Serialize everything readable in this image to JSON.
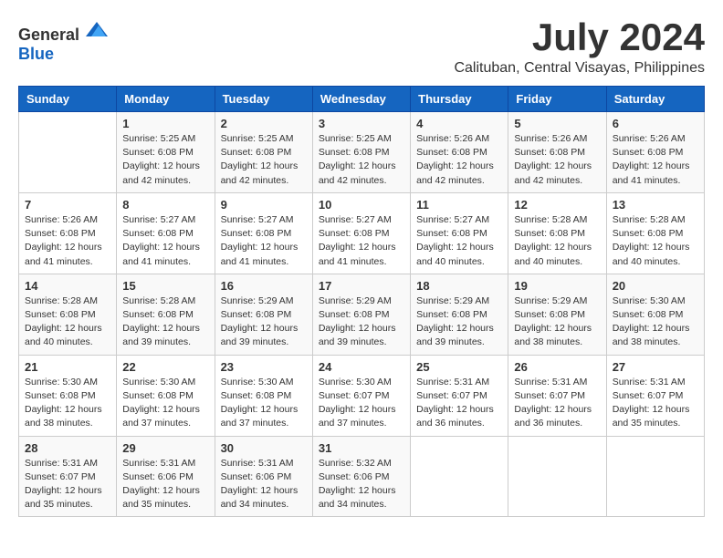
{
  "logo": {
    "text_general": "General",
    "text_blue": "Blue"
  },
  "title": "July 2024",
  "location": "Calituban, Central Visayas, Philippines",
  "header": {
    "days": [
      "Sunday",
      "Monday",
      "Tuesday",
      "Wednesday",
      "Thursday",
      "Friday",
      "Saturday"
    ]
  },
  "weeks": [
    {
      "cells": [
        {
          "day": "",
          "detail": ""
        },
        {
          "day": "1",
          "detail": "Sunrise: 5:25 AM\nSunset: 6:08 PM\nDaylight: 12 hours\nand 42 minutes."
        },
        {
          "day": "2",
          "detail": "Sunrise: 5:25 AM\nSunset: 6:08 PM\nDaylight: 12 hours\nand 42 minutes."
        },
        {
          "day": "3",
          "detail": "Sunrise: 5:25 AM\nSunset: 6:08 PM\nDaylight: 12 hours\nand 42 minutes."
        },
        {
          "day": "4",
          "detail": "Sunrise: 5:26 AM\nSunset: 6:08 PM\nDaylight: 12 hours\nand 42 minutes."
        },
        {
          "day": "5",
          "detail": "Sunrise: 5:26 AM\nSunset: 6:08 PM\nDaylight: 12 hours\nand 42 minutes."
        },
        {
          "day": "6",
          "detail": "Sunrise: 5:26 AM\nSunset: 6:08 PM\nDaylight: 12 hours\nand 41 minutes."
        }
      ]
    },
    {
      "cells": [
        {
          "day": "7",
          "detail": "Sunrise: 5:26 AM\nSunset: 6:08 PM\nDaylight: 12 hours\nand 41 minutes."
        },
        {
          "day": "8",
          "detail": "Sunrise: 5:27 AM\nSunset: 6:08 PM\nDaylight: 12 hours\nand 41 minutes."
        },
        {
          "day": "9",
          "detail": "Sunrise: 5:27 AM\nSunset: 6:08 PM\nDaylight: 12 hours\nand 41 minutes."
        },
        {
          "day": "10",
          "detail": "Sunrise: 5:27 AM\nSunset: 6:08 PM\nDaylight: 12 hours\nand 41 minutes."
        },
        {
          "day": "11",
          "detail": "Sunrise: 5:27 AM\nSunset: 6:08 PM\nDaylight: 12 hours\nand 40 minutes."
        },
        {
          "day": "12",
          "detail": "Sunrise: 5:28 AM\nSunset: 6:08 PM\nDaylight: 12 hours\nand 40 minutes."
        },
        {
          "day": "13",
          "detail": "Sunrise: 5:28 AM\nSunset: 6:08 PM\nDaylight: 12 hours\nand 40 minutes."
        }
      ]
    },
    {
      "cells": [
        {
          "day": "14",
          "detail": "Sunrise: 5:28 AM\nSunset: 6:08 PM\nDaylight: 12 hours\nand 40 minutes."
        },
        {
          "day": "15",
          "detail": "Sunrise: 5:28 AM\nSunset: 6:08 PM\nDaylight: 12 hours\nand 39 minutes."
        },
        {
          "day": "16",
          "detail": "Sunrise: 5:29 AM\nSunset: 6:08 PM\nDaylight: 12 hours\nand 39 minutes."
        },
        {
          "day": "17",
          "detail": "Sunrise: 5:29 AM\nSunset: 6:08 PM\nDaylight: 12 hours\nand 39 minutes."
        },
        {
          "day": "18",
          "detail": "Sunrise: 5:29 AM\nSunset: 6:08 PM\nDaylight: 12 hours\nand 39 minutes."
        },
        {
          "day": "19",
          "detail": "Sunrise: 5:29 AM\nSunset: 6:08 PM\nDaylight: 12 hours\nand 38 minutes."
        },
        {
          "day": "20",
          "detail": "Sunrise: 5:30 AM\nSunset: 6:08 PM\nDaylight: 12 hours\nand 38 minutes."
        }
      ]
    },
    {
      "cells": [
        {
          "day": "21",
          "detail": "Sunrise: 5:30 AM\nSunset: 6:08 PM\nDaylight: 12 hours\nand 38 minutes."
        },
        {
          "day": "22",
          "detail": "Sunrise: 5:30 AM\nSunset: 6:08 PM\nDaylight: 12 hours\nand 37 minutes."
        },
        {
          "day": "23",
          "detail": "Sunrise: 5:30 AM\nSunset: 6:08 PM\nDaylight: 12 hours\nand 37 minutes."
        },
        {
          "day": "24",
          "detail": "Sunrise: 5:30 AM\nSunset: 6:07 PM\nDaylight: 12 hours\nand 37 minutes."
        },
        {
          "day": "25",
          "detail": "Sunrise: 5:31 AM\nSunset: 6:07 PM\nDaylight: 12 hours\nand 36 minutes."
        },
        {
          "day": "26",
          "detail": "Sunrise: 5:31 AM\nSunset: 6:07 PM\nDaylight: 12 hours\nand 36 minutes."
        },
        {
          "day": "27",
          "detail": "Sunrise: 5:31 AM\nSunset: 6:07 PM\nDaylight: 12 hours\nand 35 minutes."
        }
      ]
    },
    {
      "cells": [
        {
          "day": "28",
          "detail": "Sunrise: 5:31 AM\nSunset: 6:07 PM\nDaylight: 12 hours\nand 35 minutes."
        },
        {
          "day": "29",
          "detail": "Sunrise: 5:31 AM\nSunset: 6:06 PM\nDaylight: 12 hours\nand 35 minutes."
        },
        {
          "day": "30",
          "detail": "Sunrise: 5:31 AM\nSunset: 6:06 PM\nDaylight: 12 hours\nand 34 minutes."
        },
        {
          "day": "31",
          "detail": "Sunrise: 5:32 AM\nSunset: 6:06 PM\nDaylight: 12 hours\nand 34 minutes."
        },
        {
          "day": "",
          "detail": ""
        },
        {
          "day": "",
          "detail": ""
        },
        {
          "day": "",
          "detail": ""
        }
      ]
    }
  ]
}
